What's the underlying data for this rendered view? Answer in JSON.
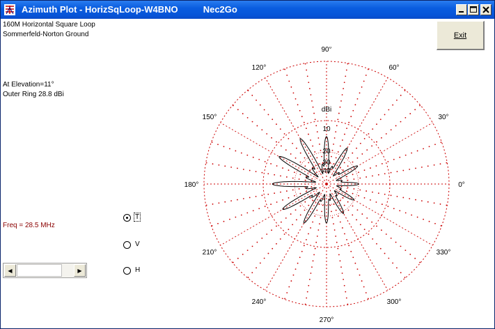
{
  "window": {
    "title": "Azimuth Plot - HorizSqLoop-W4BNO          Nec2Go",
    "icon": "antenna-app-icon"
  },
  "header": {
    "line1": "160M Horizontal Square Loop",
    "line2": "Sommerfeld-Norton Ground"
  },
  "info": {
    "elevation": "At Elevation=11°",
    "outer_ring": "Outer Ring 28.8 dBi",
    "freq": "Freq = 28.5 MHz"
  },
  "buttons": {
    "exit": "Exit"
  },
  "radio": {
    "options": [
      "T",
      "V",
      "H"
    ],
    "selected": "T"
  },
  "polar": {
    "unit": "dBi",
    "ring_labels": [
      "10",
      "20",
      "30",
      "40"
    ],
    "angle_labels": [
      "90°",
      "60°",
      "30°",
      "0°",
      "330°",
      "300°",
      "270°",
      "240°",
      "210°",
      "180°",
      "150°",
      "120°"
    ],
    "grid_color": "#cc0000",
    "trace_color": "#000000"
  }
}
